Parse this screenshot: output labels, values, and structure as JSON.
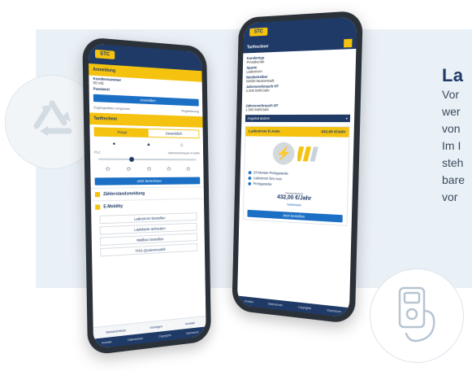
{
  "side_text": {
    "heading": "La",
    "lines": [
      "Vor",
      "wer",
      "von",
      "Im I",
      "steh",
      "bare",
      "vor"
    ]
  },
  "icons": {
    "recycle": "recycle-icon",
    "charger": "ev-charger-icon"
  },
  "colors": {
    "navy": "#1f3a66",
    "yellow": "#f4c20f",
    "blue": "#1b6fc4",
    "panel": "#e9f0f6"
  },
  "left_phone": {
    "logo": "STC",
    "anmeldung": {
      "title": "Anmeldung",
      "kundennr_label": "Kundennummer",
      "kundennr_value": "00 mE",
      "passwort_label": "Passwort",
      "login_button": "Anmelden",
      "forgot": "Zugangsdaten vergessen",
      "register": "Registrierung"
    },
    "tarifrechner": {
      "title": "Tarifrechner",
      "toggle": [
        "Privat",
        "Gewerblich"
      ],
      "plz_label": "PLZ",
      "verbrauch_label": "Jahresverbrauch in kWh",
      "button": "Jetzt berechnen"
    },
    "zaehlerstand": "Zählerstandsmeldung",
    "emobility": {
      "title": "E-Mobility",
      "buttons": [
        "Ladestrom bestellen",
        "Ladekarte anfordern",
        "Wallbox bestellen",
        "THG-Quotenmodell"
      ]
    },
    "footer_tabs": [
      "Netzanschluss",
      "Kündigen",
      "Kontakt"
    ],
    "footer_links": [
      "Kontakt",
      "Datenschutz",
      "Copyrights",
      "Impressum"
    ]
  },
  "right_phone": {
    "logo": "STC",
    "header": "Tarifrechner",
    "fields": [
      {
        "label": "Kundentyp",
        "value": "Privatkunde"
      },
      {
        "label": "Sparte",
        "value": "Ladestrom"
      },
      {
        "label": "Netzbetreiber",
        "value": "00000 Musterstadt"
      },
      {
        "label": "Jahresverbrauch HT",
        "value": "2.000 kWh/Jahr"
      },
      {
        "label": "Jahresverbrauch NT",
        "value": "1.000 kWh/Jahr"
      }
    ],
    "dropdown": "Angebot ändern",
    "card": {
      "title": "Ladestrom E-Auto",
      "tag": "432,00 €/Jahr",
      "bullets": [
        "24 Monate Preisgarantie",
        "Ladestrom fürs Auto",
        "Preisgarantie"
      ],
      "price_label": "Gesamtpreis",
      "price": "432,00 €/Jahr",
      "details_link": "Tarifdetails",
      "button": "Jetzt bestellen"
    },
    "footer_links": [
      "Kontakt",
      "Datenschutz",
      "Copyrights",
      "Impressum"
    ]
  }
}
